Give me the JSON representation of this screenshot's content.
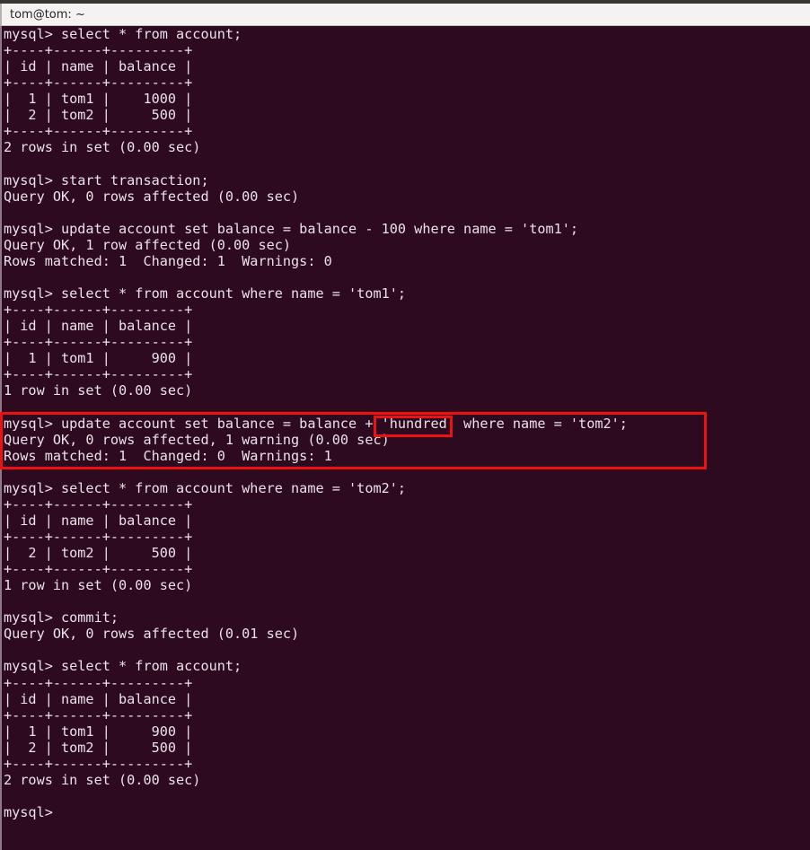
{
  "window": {
    "title": "tom@tom: ~",
    "app": "gnome-terminal"
  },
  "theme": {
    "terminal_background": "#2d0a1f",
    "terminal_foreground": "#ebe2e8",
    "titlebar_background": "#f4f3f2",
    "titlebar_foreground": "#2a2422",
    "annotation_color": "#ee1111"
  },
  "terminal": {
    "lines": [
      "mysql> select * from account;",
      "+----+------+---------+",
      "| id | name | balance |",
      "+----+------+---------+",
      "|  1 | tom1 |    1000 |",
      "|  2 | tom2 |     500 |",
      "+----+------+---------+",
      "2 rows in set (0.00 sec)",
      "",
      "mysql> start transaction;",
      "Query OK, 0 rows affected (0.00 sec)",
      "",
      "mysql> update account set balance = balance - 100 where name = 'tom1';",
      "Query OK, 1 row affected (0.00 sec)",
      "Rows matched: 1  Changed: 1  Warnings: 0",
      "",
      "mysql> select * from account where name = 'tom1';",
      "+----+------+---------+",
      "| id | name | balance |",
      "+----+------+---------+",
      "|  1 | tom1 |     900 |",
      "+----+------+---------+",
      "1 row in set (0.00 sec)",
      "",
      "mysql> update account set balance = balance + 'hundred' where name = 'tom2';",
      "Query OK, 0 rows affected, 1 warning (0.00 sec)",
      "Rows matched: 1  Changed: 0  Warnings: 1",
      "",
      "mysql> select * from account where name = 'tom2';",
      "+----+------+---------+",
      "| id | name | balance |",
      "+----+------+---------+",
      "|  2 | tom2 |     500 |",
      "+----+------+---------+",
      "1 row in set (0.00 sec)",
      "",
      "mysql> commit;",
      "Query OK, 0 rows affected (0.01 sec)",
      "",
      "mysql> select * from account;",
      "+----+------+---------+",
      "| id | name | balance |",
      "+----+------+---------+",
      "|  1 | tom1 |     900 |",
      "|  2 | tom2 |     500 |",
      "+----+------+---------+",
      "2 rows in set (0.00 sec)",
      "",
      "mysql> "
    ],
    "prompt": "mysql> "
  },
  "annotations": {
    "outer_box_label": "failed-update-statement-block",
    "inner_box_label": "hundred-literal-highlight",
    "highlighted_token": "'hundred'"
  }
}
